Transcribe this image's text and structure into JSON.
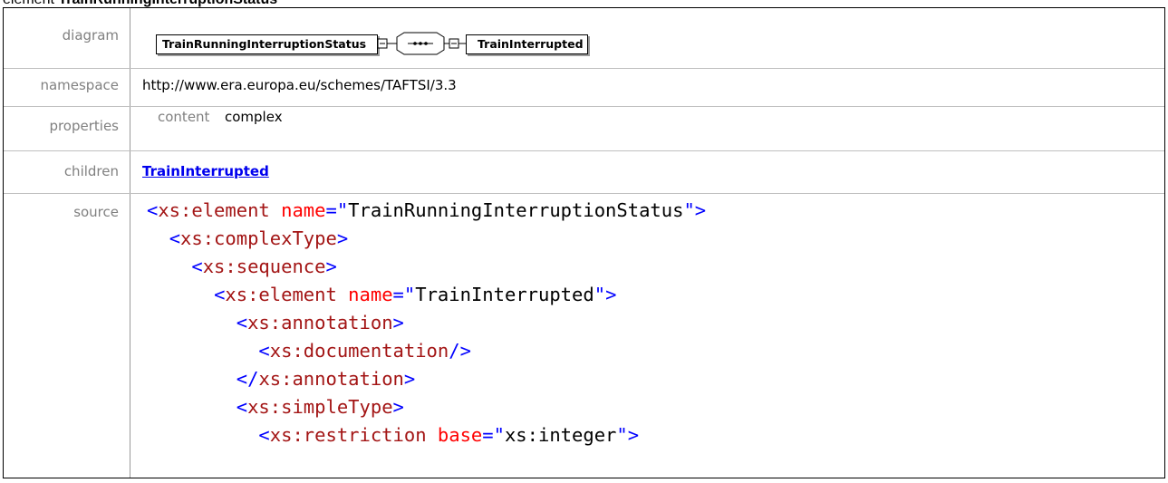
{
  "title": {
    "prefix": "element ",
    "name": "TrainRunningInterruptionStatus"
  },
  "rows": {
    "diagram": {
      "label": "diagram"
    },
    "namespace": {
      "label": "namespace",
      "value": "http://www.era.europa.eu/schemes/TAFTSI/3.3"
    },
    "properties": {
      "label": "properties",
      "key": "content",
      "value": "complex"
    },
    "children": {
      "label": "children",
      "link": "TrainInterrupted"
    },
    "source": {
      "label": "source"
    }
  },
  "diagram": {
    "parent": "TrainRunningInterruptionStatus",
    "sequence_symbol": "•••",
    "child": "TrainInterrupted"
  },
  "source": {
    "lines": [
      {
        "indent": "",
        "tag": "xs:element",
        "attr": "name",
        "val": "TrainRunningInterruptionStatus",
        "close": ">"
      },
      {
        "indent": "  ",
        "tag": "xs:complexType",
        "close": ">"
      },
      {
        "indent": "    ",
        "tag": "xs:sequence",
        "close": ">"
      },
      {
        "indent": "      ",
        "tag": "xs:element",
        "attr": "name",
        "val": "TrainInterrupted",
        "close": ">"
      },
      {
        "indent": "        ",
        "tag": "xs:annotation",
        "close": ">"
      },
      {
        "indent": "          ",
        "tag": "xs:documentation",
        "close": "/>"
      },
      {
        "indent": "        ",
        "closing": true,
        "tag": "xs:annotation",
        "close": ">"
      },
      {
        "indent": "        ",
        "tag": "xs:simpleType",
        "close": ">"
      },
      {
        "indent": "          ",
        "tag": "xs:restriction",
        "attr": "base",
        "val": "xs:integer",
        "close": ">"
      }
    ]
  }
}
